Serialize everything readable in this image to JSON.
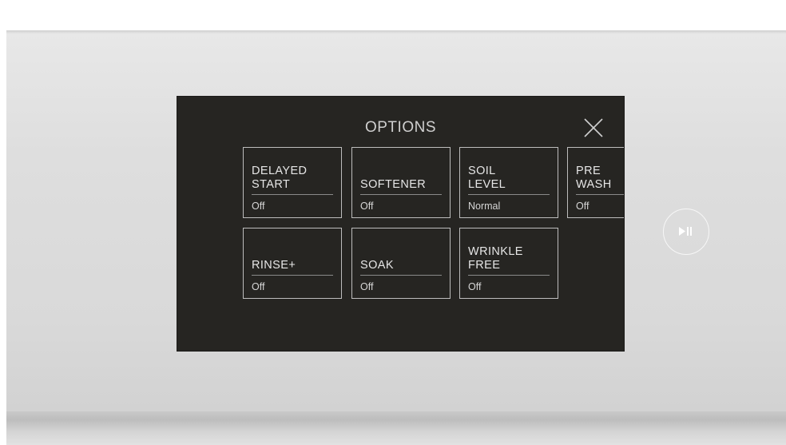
{
  "screen": {
    "title": "OPTIONS",
    "close_icon": "close-icon"
  },
  "options": [
    {
      "label": "DELAYED\nSTART",
      "value": "Off"
    },
    {
      "label": "SOFTENER",
      "value": "Off"
    },
    {
      "label": "SOIL\nLEVEL",
      "value": "Normal"
    },
    {
      "label": "PRE\nWASH",
      "value": "Off"
    },
    {
      "label": "RINSE+",
      "value": "Off"
    },
    {
      "label": "SOAK",
      "value": "Off"
    },
    {
      "label": "WRINKLE\nFREE",
      "value": "Off"
    }
  ],
  "controls": {
    "play_pause_icon": "play-pause-icon"
  },
  "colors": {
    "screen_bg": "#262522",
    "tile_border": "#bdbdbd",
    "text": "#e6e6e6",
    "panel": "#dcdcdc"
  }
}
